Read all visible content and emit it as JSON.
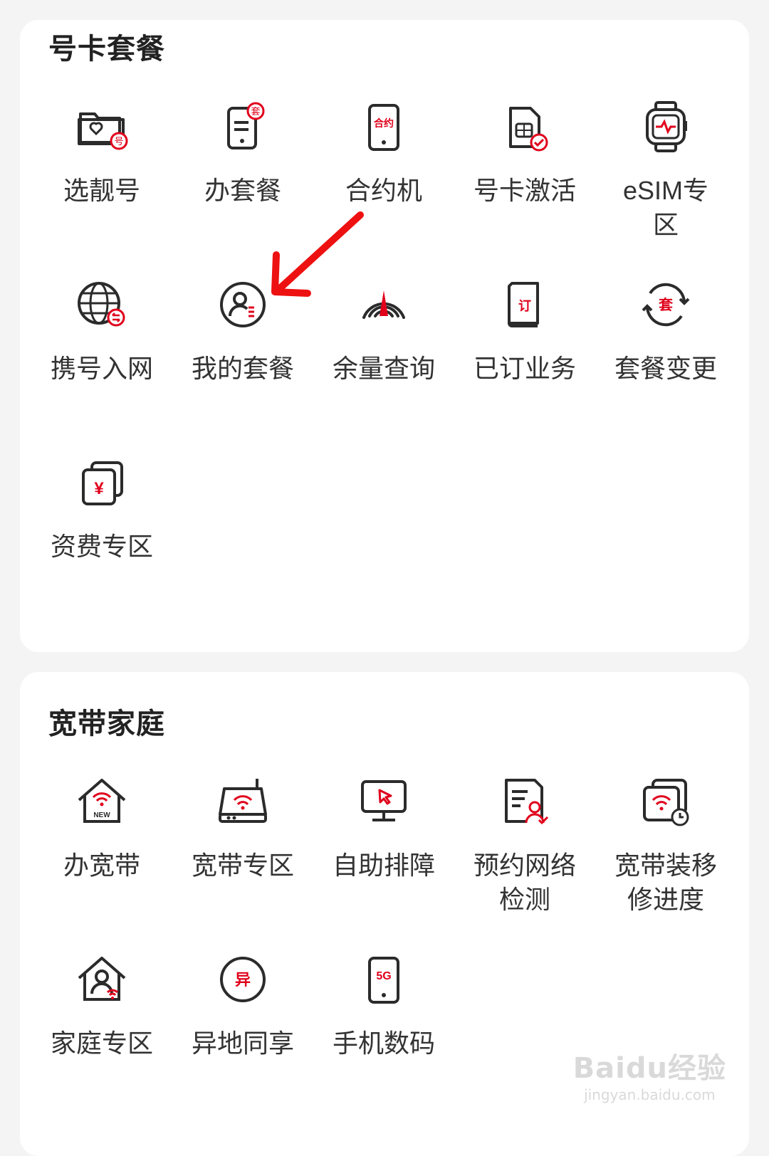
{
  "sections": [
    {
      "title": "号卡套餐",
      "items": [
        {
          "label": "选靓号",
          "icon": "folder-heart-icon"
        },
        {
          "label": "办套餐",
          "icon": "phone-plan-icon"
        },
        {
          "label": "合约机",
          "icon": "contract-phone-icon"
        },
        {
          "label": "号卡激活",
          "icon": "sim-activate-icon"
        },
        {
          "label": "eSIM专区",
          "icon": "smartwatch-icon"
        },
        {
          "label": "携号入网",
          "icon": "globe-transfer-icon"
        },
        {
          "label": "我的套餐",
          "icon": "user-plan-icon"
        },
        {
          "label": "余量查询",
          "icon": "gauge-icon"
        },
        {
          "label": "已订业务",
          "icon": "subscription-doc-icon"
        },
        {
          "label": "套餐变更",
          "icon": "plan-change-icon"
        },
        {
          "label": "资费专区",
          "icon": "yuan-cards-icon"
        }
      ]
    },
    {
      "title": "宽带家庭",
      "items": [
        {
          "label": "办宽带",
          "icon": "home-wifi-new-icon"
        },
        {
          "label": "宽带专区",
          "icon": "router-icon"
        },
        {
          "label": "自助排障",
          "icon": "monitor-cursor-icon"
        },
        {
          "label": "预约网络检测",
          "icon": "doc-user-icon"
        },
        {
          "label": "宽带装移修进度",
          "icon": "wifi-clock-icon"
        },
        {
          "label": "家庭专区",
          "icon": "home-user-icon"
        },
        {
          "label": "异地同享",
          "icon": "circle-yi-icon"
        },
        {
          "label": "手机数码",
          "icon": "phone-5g-icon"
        }
      ]
    }
  ],
  "icon_text": {
    "folder_badge": "号",
    "plan_badge": "套",
    "contract": "合约",
    "order": "订",
    "plan_change": "套",
    "yuan": "¥",
    "new": "NEW",
    "yi": "异",
    "five_g": "5G"
  },
  "watermark": {
    "main": "Baidu经验",
    "sub": "jingyan.baidu.com"
  },
  "colors": {
    "accent": "#e0001b",
    "stroke": "#2b2b2b"
  }
}
